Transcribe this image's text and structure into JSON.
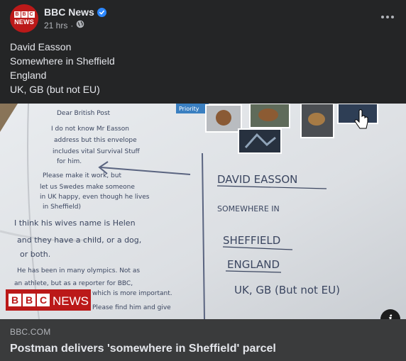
{
  "header": {
    "page_name": "BBC News",
    "timestamp": "21 hrs",
    "avatar_letters": [
      "B",
      "B",
      "C"
    ],
    "avatar_word": "NEWS",
    "verified_icon": "verified-badge-icon",
    "privacy_icon": "globe-icon",
    "menu_icon": "more-options-icon"
  },
  "caption": {
    "lines": [
      "David Easson",
      "Somewhere in Sheffield",
      "England",
      "UK, GB (but not EU)"
    ]
  },
  "photo": {
    "watermark_letters": [
      "B",
      "B",
      "C"
    ],
    "watermark_word": "NEWS",
    "envelope_label": "Priority",
    "address_lines": [
      "DAVID EASSON",
      "SOMEWHERE IN",
      "SHEFFIELD",
      "ENGLAND",
      "UK, GB (But not EU)"
    ],
    "note_lines": [
      "Dear British Post",
      "I do not know Mr Easson",
      "address but this envelope",
      "includes vital Survival Stuff",
      "for him.",
      "Please make it work, but",
      "let us Swedes make someone",
      "in UK happy, even though he lives",
      "in Sheffield)",
      "I think his wives name is Helen",
      "and they have a child, or a dog,",
      "or both.",
      "He has been in many olympics. Not as",
      "an athlete, but as a reporter for BBC,",
      "which is more important.",
      "Please find him and give"
    ]
  },
  "link": {
    "domain": "BBC.COM",
    "headline": "Postman delivers 'somewhere in Sheffield' parcel"
  },
  "info_icon": "info-icon",
  "colors": {
    "background": "#242526",
    "link_footer": "#3a3b3c",
    "bbc_red": "#bb1919",
    "verified_blue": "#2d88ff"
  }
}
